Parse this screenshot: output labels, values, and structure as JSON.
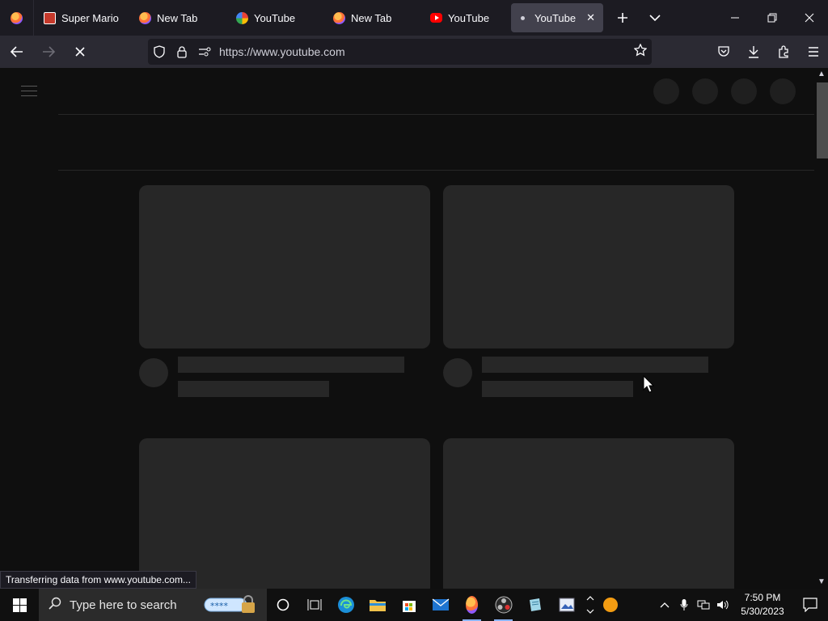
{
  "browser": {
    "tabs": [
      {
        "title": "Super Mario W",
        "favicon": "wikia-icon",
        "active": false
      },
      {
        "title": "New Tab",
        "favicon": "firefox-icon",
        "active": false
      },
      {
        "title": "YouTube",
        "favicon": "google-icon",
        "active": false
      },
      {
        "title": "New Tab",
        "favicon": "firefox-icon",
        "active": false
      },
      {
        "title": "YouTube",
        "favicon": "youtube-icon",
        "active": false
      },
      {
        "title": "YouTube",
        "favicon": "loading-dot-icon",
        "active": true
      }
    ],
    "url": "https://www.youtube.com",
    "status_text": "Transferring data from www.youtube.com..."
  },
  "taskbar": {
    "search_placeholder": "Type here to search",
    "clock_time": "7:50 PM",
    "clock_date": "5/30/2023"
  },
  "colors": {
    "page_bg": "#0f0f0f",
    "skeleton": "#272727",
    "tab_bg": "#1c1b22",
    "toolbar_bg": "#2b2a33"
  }
}
